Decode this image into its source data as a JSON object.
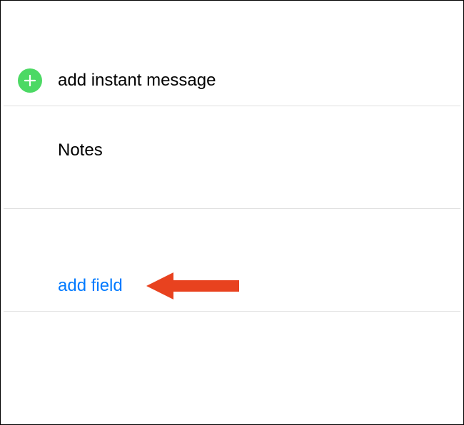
{
  "rows": {
    "addInstantMessage": {
      "label": "add instant message"
    },
    "notes": {
      "label": "Notes"
    },
    "addField": {
      "label": "add field"
    }
  },
  "icons": {
    "plus": "plus-icon"
  },
  "colors": {
    "accent": "#007aff",
    "plusBg": "#4cd964",
    "arrow": "#e8421f"
  }
}
